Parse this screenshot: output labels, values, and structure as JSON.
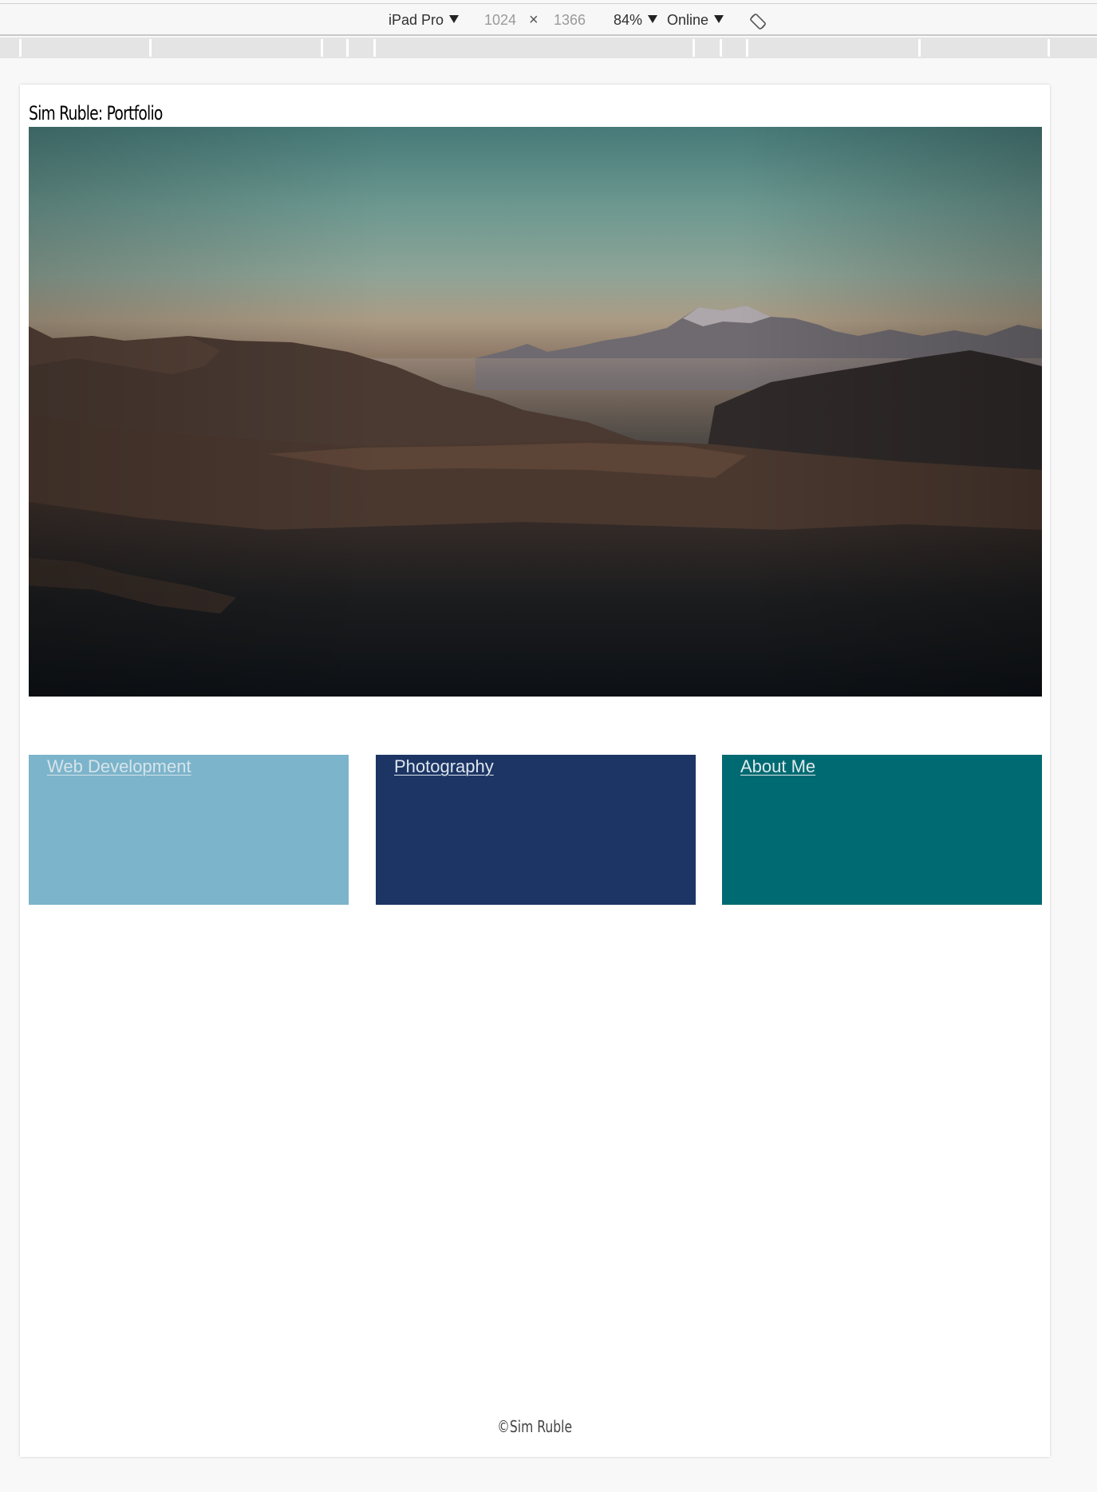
{
  "device_toolbar": {
    "device": "iPad Pro",
    "width": "1024",
    "times": "×",
    "height": "1366",
    "zoom": "84%",
    "network": "Online",
    "rotate_icon": "rotate-device-icon"
  },
  "page": {
    "site_title": "Sim Ruble: Portfolio",
    "hero_image": "mountain-landscape-at-dusk",
    "cards": [
      {
        "label": "Web Development",
        "background": "#7cb4cb",
        "link_color": "#d6e4ea"
      },
      {
        "label": "Photography",
        "background": "#1c3564",
        "link_color": "#dfe6ef"
      },
      {
        "label": "About Me",
        "background": "#006a72",
        "link_color": "#dfeaec"
      }
    ],
    "footer": "©Sim Ruble"
  }
}
